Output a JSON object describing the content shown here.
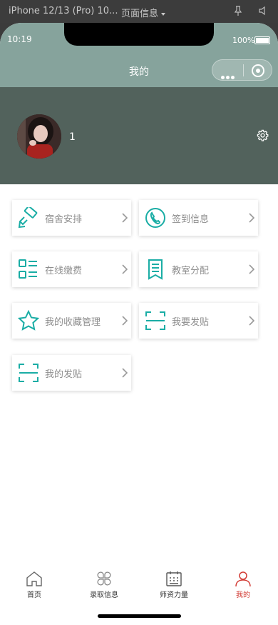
{
  "simulator": {
    "device": "iPhone 12/13 (Pro) 10...",
    "page_info": "页面信息"
  },
  "status_bar": {
    "time": "10:19",
    "battery": "100%"
  },
  "nav": {
    "title": "我的"
  },
  "profile": {
    "username": "1"
  },
  "menu": [
    {
      "label": "宿舍安排",
      "icon": "roller-icon"
    },
    {
      "label": "签到信息",
      "icon": "phone-icon"
    },
    {
      "label": "在线缴费",
      "icon": "list-icon"
    },
    {
      "label": "教室分配",
      "icon": "document-icon"
    },
    {
      "label": "我的收藏管理",
      "icon": "star-icon"
    },
    {
      "label": "我要发贴",
      "icon": "scan-icon"
    },
    {
      "label": "我的发贴",
      "icon": "scan-icon"
    }
  ],
  "tabbar": [
    {
      "label": "首页",
      "icon": "home-icon",
      "active": false
    },
    {
      "label": "录取信息",
      "icon": "clover-icon",
      "active": false
    },
    {
      "label": "师资力量",
      "icon": "calendar-icon",
      "active": false
    },
    {
      "label": "我的",
      "icon": "user-icon",
      "active": true
    }
  ],
  "colors": {
    "status_bg": "#86a39c",
    "profile_bg": "#52625c",
    "icon_teal": "#1aada5",
    "active_tab": "#d23a33"
  }
}
